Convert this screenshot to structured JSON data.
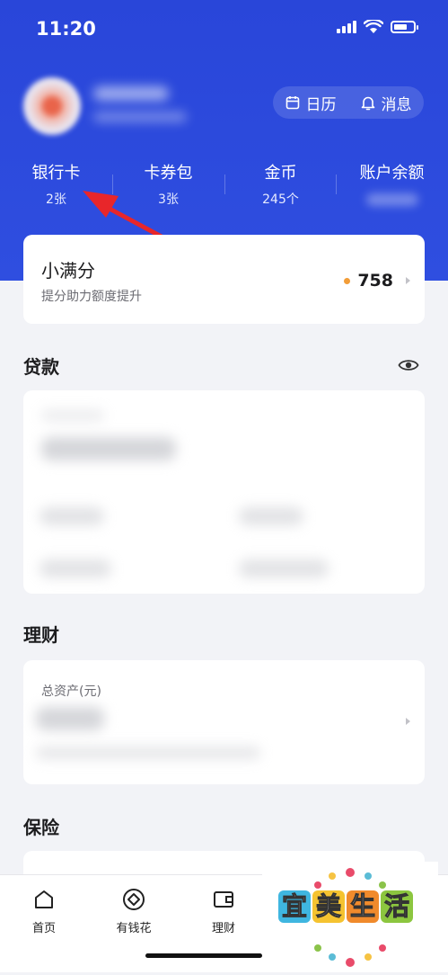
{
  "status_bar": {
    "time": "11:20"
  },
  "header": {
    "calendar_label": "日历",
    "messages_label": "消息"
  },
  "stats": [
    {
      "label": "银行卡",
      "value": "2张"
    },
    {
      "label": "卡券包",
      "value": "3张"
    },
    {
      "label": "金币",
      "value": "245个"
    },
    {
      "label": "账户余额",
      "value": ""
    }
  ],
  "score_card": {
    "title": "小满分",
    "subtitle": "提分助力额度提升",
    "score": "758"
  },
  "sections": {
    "loan_title": "贷款",
    "wealth_title": "理财",
    "wealth_total_label": "总资产(元)",
    "insurance_title": "保险"
  },
  "tabbar": [
    {
      "label": "首页",
      "icon": "home-icon"
    },
    {
      "label": "有钱花",
      "icon": "target-icon"
    },
    {
      "label": "理财",
      "icon": "wallet-icon"
    }
  ],
  "watermark": {
    "chars": [
      "宜",
      "美",
      "生",
      "活"
    ]
  },
  "colors": {
    "brand_blue": "#2f4ee0",
    "score_dot": "#f29d38",
    "arrow_red": "#e8262a"
  }
}
